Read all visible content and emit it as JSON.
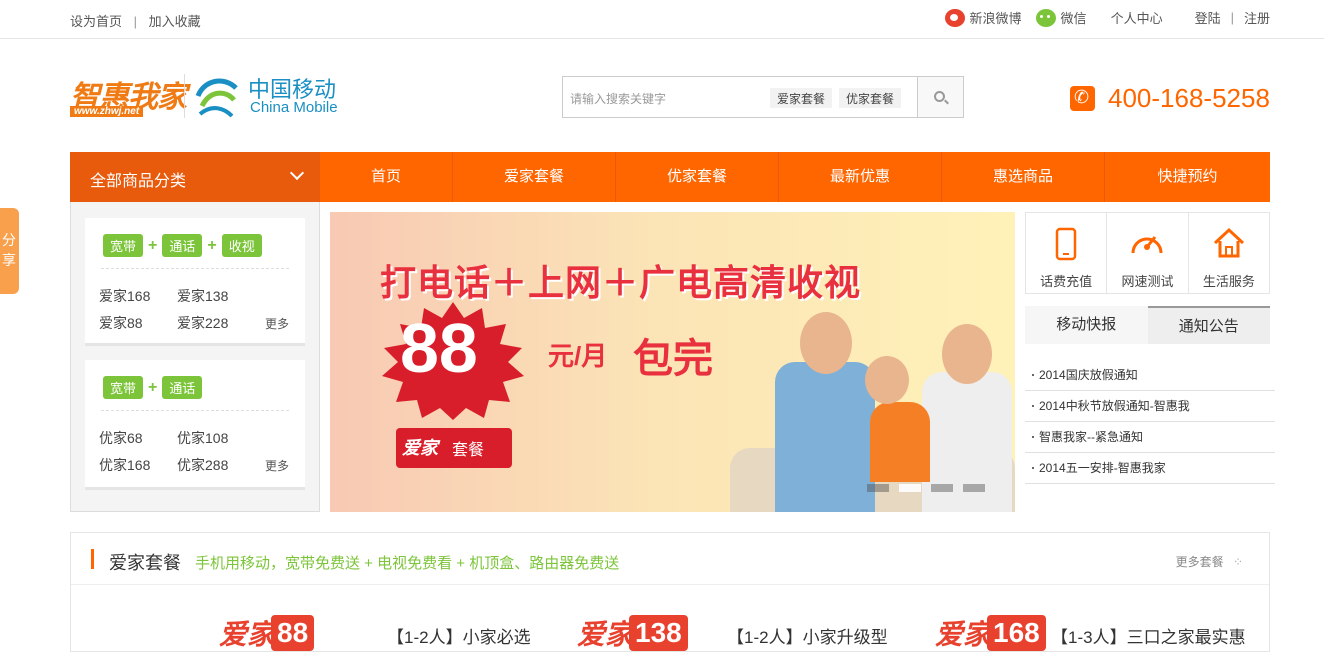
{
  "topbar": {
    "set_home": "设为首页",
    "sep": "|",
    "favorite": "加入收藏",
    "weibo": "新浪微博",
    "weixin": "微信",
    "user_center": "个人中心",
    "login": "登陆",
    "register": "注册"
  },
  "logo": {
    "brand": "智惠我家",
    "url": "www.zhwj.net",
    "carrier_cn": "中国移动",
    "carrier_en": "China Mobile"
  },
  "search": {
    "placeholder": "请输入搜索关键字",
    "tag1": "爱家套餐",
    "tag2": "优家套餐"
  },
  "hotline": "400-168-5258",
  "nav": {
    "category": "全部商品分类",
    "items": [
      "首页",
      "爱家套餐",
      "优家套餐",
      "最新优惠",
      "惠选商品",
      "快捷预约"
    ]
  },
  "side": {
    "card1": {
      "tags": [
        "宽带",
        "通话",
        "收视"
      ],
      "packages": [
        "爱家168",
        "爱家138",
        "爱家88",
        "爱家228"
      ],
      "more": "更多"
    },
    "card2": {
      "tags": [
        "宽带",
        "通话"
      ],
      "packages": [
        "优家68",
        "优家108",
        "优家168",
        "优家288"
      ],
      "more": "更多"
    }
  },
  "banner": {
    "headline": "打电话＋上网＋广电高清收视",
    "price": "88",
    "unit": "元/月",
    "baowan": "包完",
    "stamp_left": "爱家",
    "stamp_right": "套餐"
  },
  "services": [
    "话费充值",
    "网速测试",
    "生活服务"
  ],
  "tabs": [
    "移动快报",
    "通知公告"
  ],
  "news": [
    "2014国庆放假通知",
    "2014中秋节放假通知-智惠我",
    "智惠我家--紧急通知",
    "2014五一安排-智惠我家"
  ],
  "share": "分享",
  "section": {
    "title": "爱家套餐",
    "slogan": "手机用移动，宽带免费送 + 电视免费看 + 机顶盒、路由器免费送",
    "more": "更多套餐",
    "products": [
      {
        "brand": "爱家",
        "price": "88",
        "name": ""
      },
      {
        "brand": "",
        "price": "",
        "name": "【1-2人】小家必选"
      },
      {
        "brand": "爱家",
        "price": "138",
        "name": "【1-2人】小家升级型"
      },
      {
        "brand": "爱家",
        "price": "168",
        "name": "【1-3人】三口之家最实惠"
      }
    ]
  },
  "colors": {
    "brand_orange": "#ff6600",
    "nav_dark": "#e85a0c",
    "green": "#7cc53a",
    "red": "#e8303e"
  }
}
